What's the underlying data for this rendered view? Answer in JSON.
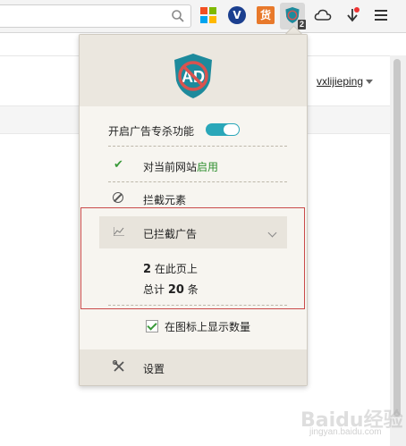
{
  "toolbar": {
    "ad_badge_count": "2",
    "icons": [
      "search-icon",
      "ms-apps-icon",
      "v-extension-icon",
      "huo-extension-icon",
      "adblock-icon",
      "cloud-icon",
      "download-icon",
      "menu-icon"
    ],
    "huo_label": "货",
    "v_label": "V"
  },
  "page": {
    "username": "vxlijieping"
  },
  "popup": {
    "logo_text": "AD",
    "enable_label": "开启广告专杀功能",
    "enable_on": true,
    "site_label_prefix": "对当前网站",
    "site_label_status": "启用",
    "block_element_label": "拦截元素",
    "blocked_ads_label": "已拦截广告",
    "page_count": "2",
    "page_count_suffix": "在此页上",
    "total_prefix": "总计",
    "total_count": "20",
    "total_suffix": "条",
    "show_count_label": "在图标上显示数量",
    "show_count_checked": true,
    "settings_label": "设置"
  },
  "watermark": {
    "text": "Baidu经验",
    "sub": "jingyan.baidu.com"
  },
  "colors": {
    "accent": "#2aa7b9",
    "highlight_box": "#c94a4a",
    "enabled_text": "#2f8f2f"
  }
}
